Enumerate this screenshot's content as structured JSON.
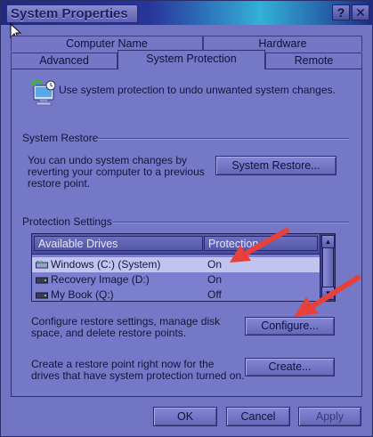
{
  "window": {
    "title": "System Properties",
    "help_label": "?",
    "close_label": "✕"
  },
  "tabs": [
    {
      "label": "Computer Name"
    },
    {
      "label": "Hardware"
    },
    {
      "label": "Advanced"
    },
    {
      "label": "System Protection",
      "selected": true
    },
    {
      "label": "Remote"
    }
  ],
  "intro": {
    "icon": "system-protection-icon",
    "text": "Use system protection to undo unwanted system changes."
  },
  "system_restore": {
    "heading": "System Restore",
    "description": "You can undo system changes by reverting your computer to a previous restore point.",
    "button_label": "System Restore..."
  },
  "protection_settings": {
    "heading": "Protection Settings",
    "columns": [
      "Available Drives",
      "Protection"
    ],
    "drives": [
      {
        "name": "Windows (C:) (System)",
        "status": "On",
        "icon": "system-drive-icon",
        "selected": true
      },
      {
        "name": "Recovery Image (D:)",
        "status": "On",
        "icon": "hard-drive-icon",
        "selected": false
      },
      {
        "name": "My Book (Q:)",
        "status": "Off",
        "icon": "hard-drive-icon",
        "selected": false
      }
    ],
    "configure_text": "Configure restore settings, manage disk space, and delete restore points.",
    "configure_button": "Configure...",
    "create_text": "Create a restore point right now for the drives that have system protection turned on.",
    "create_button": "Create..."
  },
  "footer": {
    "ok": "OK",
    "cancel": "Cancel",
    "apply": "Apply"
  },
  "colors": {
    "window_bg": "#7174c2",
    "annotation_arrow": "#e8403a"
  }
}
